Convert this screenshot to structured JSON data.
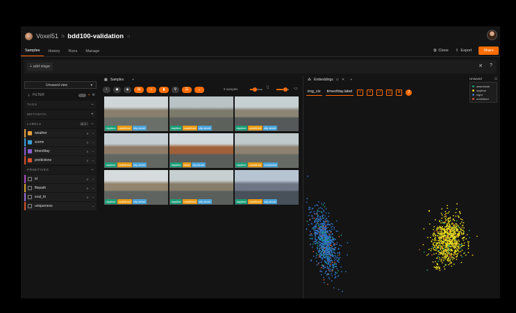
{
  "header": {
    "brand": "Voxel51",
    "separator": ">",
    "dataset": "bdd100-validation"
  },
  "nav": {
    "tabs": [
      "Samples",
      "History",
      "Runs",
      "Manage"
    ],
    "clone_label": "Clone",
    "export_label": "Export",
    "share_label": "Share"
  },
  "stage": {
    "add_label": "+ add stage"
  },
  "sidebar": {
    "view_select": "Unsaved view",
    "filter_label": "FILTER",
    "tags_label": "TAGS",
    "metadata_label": "METADATA",
    "labels_label": "LABELS",
    "primitives_label": "PRIMITIVES",
    "labels": [
      {
        "name": "weather",
        "count": "4",
        "color": "#e8a13b",
        "checked": true
      },
      {
        "name": "scene",
        "count": "4",
        "color": "#3aa0d9",
        "checked": true
      },
      {
        "name": "timeofday",
        "count": "4",
        "color": "#8a5fd0",
        "checked": true
      },
      {
        "name": "predictions",
        "count": "4",
        "color": "#d9522b",
        "checked": true
      }
    ],
    "primitives": [
      {
        "name": "id",
        "count": "4",
        "color": "#b04fc9"
      },
      {
        "name": "filepath",
        "count": "4",
        "color": "#d6a72b"
      },
      {
        "name": "eval_fn",
        "count": "4",
        "color": "#9a6bd6"
      },
      {
        "name": "uniqueness",
        "count": "",
        "color": "#d9522b"
      }
    ]
  },
  "samples": {
    "tab_label": "Samples",
    "count_label": "9 samples",
    "tiles": [
      {
        "tags": [
          "daytime",
          "undefined",
          "city street"
        ],
        "sky": "#cfd6d8",
        "road": "#6b6f6a",
        "mid": "#8a7f6e"
      },
      {
        "tags": [
          "daytime",
          "undefined",
          "city street"
        ],
        "sky": "#b9c3c6",
        "road": "#5d615c",
        "mid": "#7c7a6b"
      },
      {
        "tags": [
          "daytime",
          "undefined",
          "city street"
        ],
        "sky": "#c6cfd1",
        "road": "#55595a",
        "mid": "#8b8576"
      },
      {
        "tags": [
          "daytime",
          "undefined",
          "city street"
        ],
        "sky": "#c4ced2",
        "road": "#626762",
        "mid": "#8e7c69"
      },
      {
        "tags": [
          "daytime",
          "clear",
          "city street"
        ],
        "sky": "#d0d8dc",
        "road": "#5a5e5b",
        "mid": "#a0613a"
      },
      {
        "tags": [
          "daytime",
          "undefined",
          "residential"
        ],
        "sky": "#bfc8cb",
        "road": "#666a65",
        "mid": "#8d8270"
      },
      {
        "tags": [
          "daytime",
          "undefined",
          "city street"
        ],
        "sky": "#d6dcdd",
        "road": "#606460",
        "mid": "#93846d"
      },
      {
        "tags": [
          "daytime",
          "undefined",
          "city street"
        ],
        "sky": "#c7cfd0",
        "road": "#5b5f5c",
        "mid": "#877d6b"
      },
      {
        "tags": [
          "daytime",
          "undefined",
          "city street"
        ],
        "sky": "#b7c4d2",
        "road": "#48505a",
        "mid": "#6e7585"
      }
    ]
  },
  "embeddings": {
    "tab_label": "Embeddings",
    "brain_key": "img_viz",
    "color_by": "timeofday.label",
    "legend_title": "Unsaved",
    "legend": [
      {
        "label": "dawn/dusk",
        "color": "#1b9e77"
      },
      {
        "label": "daytime",
        "color": "#e6d81e"
      },
      {
        "label": "night",
        "color": "#2f72c4"
      },
      {
        "label": "undefined",
        "color": "#d9522b"
      }
    ]
  }
}
